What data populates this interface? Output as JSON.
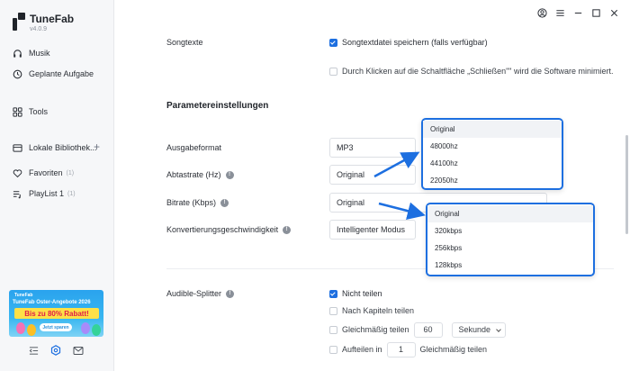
{
  "app": {
    "name": "TuneFab",
    "version": "v4.0.9"
  },
  "sidebar": {
    "items": [
      {
        "label": "Musik"
      },
      {
        "label": "Geplante Aufgabe"
      },
      {
        "label": "Tools"
      },
      {
        "label": "Lokale Bibliothek..."
      },
      {
        "label": "Favoriten",
        "count": "(1)"
      },
      {
        "label": "PlayList 1",
        "count": "(1)"
      }
    ],
    "banner": {
      "brand": "TuneFab",
      "headline": "TuneFab Oster-Angebote 2026",
      "discount": "Bis zu 80% Rabatt!",
      "cta": "Jetzt sparen"
    }
  },
  "settings": {
    "songtexte_label": "Songtexte",
    "songtexte_option": "Songtextdatei speichern (falls verfügbar)",
    "close_option": "Durch Klicken auf die Schaltfläche „Schließen\"\" wird die Software minimiert.",
    "param_title": "Parametereinstellungen",
    "ausgabeformat_label": "Ausgabeformat",
    "ausgabeformat_value": "MP3",
    "abtastrate_label": "Abtastrate (Hz)",
    "abtastrate_value": "Original",
    "bitrate_label": "Bitrate (Kbps)",
    "bitrate_value": "Original",
    "konvert_label": "Konvertierungsgeschwindigkeit",
    "konvert_value": "Intelligenter Modus",
    "audible_label": "Audible-Splitter",
    "split_none": "Nicht teilen",
    "split_chapters": "Nach Kapiteln teilen",
    "split_even": "Gleichmäßig teilen",
    "split_even_value": "60",
    "split_even_unit": "Sekunde",
    "split_in": "Aufteilen in",
    "split_in_value": "1",
    "split_in_suffix": "Gleichmäßig teilen"
  },
  "dropdown_samplerate": {
    "options": [
      "Original",
      "48000hz",
      "44100hz",
      "22050hz"
    ]
  },
  "dropdown_bitrate": {
    "options": [
      "Original",
      "320kbps",
      "256kbps",
      "128kbps"
    ]
  },
  "colors": {
    "accent": "#1d6fe0",
    "sidebar_bg": "#f6f7f9"
  }
}
